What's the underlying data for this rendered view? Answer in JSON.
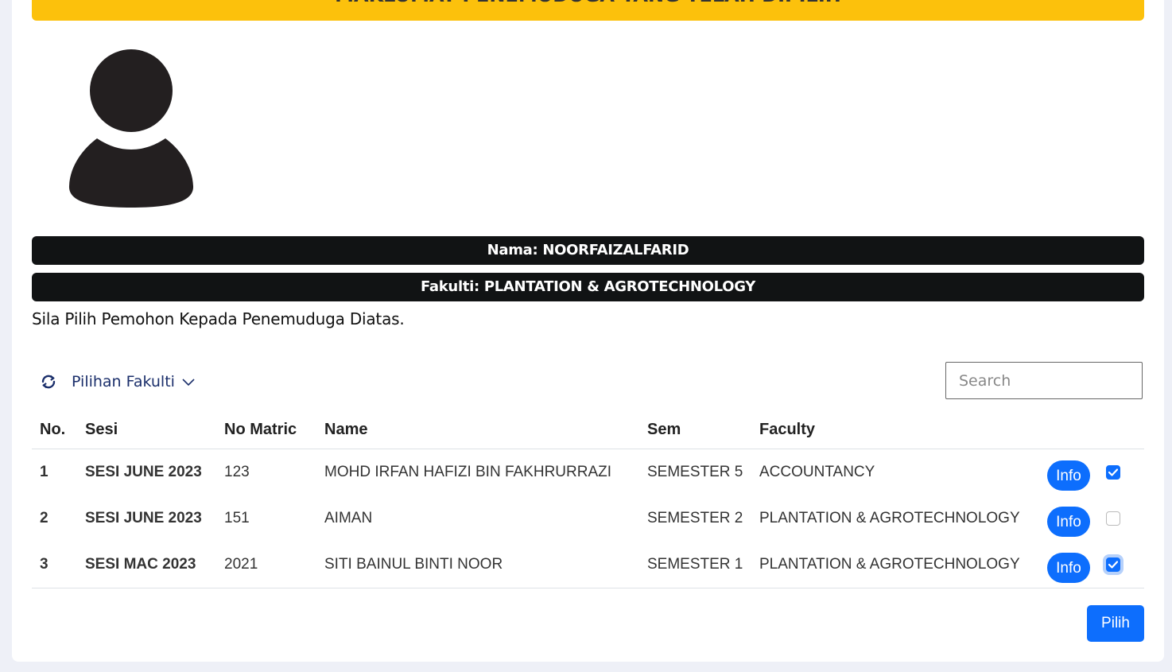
{
  "banner": {
    "text": "MAKLUMAT PENEMUDUGA YANG TELAH DIPILIH"
  },
  "profile": {
    "nama": "Nama: NOORFAIZALFARID",
    "fakulti": "Fakulti: PLANTATION & AGROTECHNOLOGY"
  },
  "instruction": "Sila Pilih Pemohon Kepada Penemuduga Diatas.",
  "toolbar": {
    "faculty_filter": "Pilihan Fakulti",
    "search_placeholder": "Search"
  },
  "table": {
    "headers": [
      "No.",
      "Sesi",
      "No Matric",
      "Name",
      "Sem",
      "Faculty"
    ],
    "rows": [
      {
        "no": "1",
        "sesi": "SESI JUNE 2023",
        "matric": "123",
        "name": "MOHD IRFAN HAFIZI BIN FAKHRURRAZI",
        "sem": "SEMESTER 5",
        "faculty": "ACCOUNTANCY",
        "info": "Info",
        "checked": true
      },
      {
        "no": "2",
        "sesi": "SESI JUNE 2023",
        "matric": "151",
        "name": "AIMAN",
        "sem": "SEMESTER 2",
        "faculty": "PLANTATION & AGROTECHNOLOGY",
        "info": "Info",
        "checked": false
      },
      {
        "no": "3",
        "sesi": "SESI MAC 2023",
        "matric": "2021",
        "name": "SITI BAINUL BINTI NOOR",
        "sem": "SEMESTER 1",
        "faculty": "PLANTATION & AGROTECHNOLOGY",
        "info": "Info",
        "checked": true
      }
    ]
  },
  "actions": {
    "pilih": "Pilih"
  },
  "colors": {
    "primary": "#0d6efd",
    "banner": "#fcc10c",
    "dark_bar": "#111314"
  }
}
